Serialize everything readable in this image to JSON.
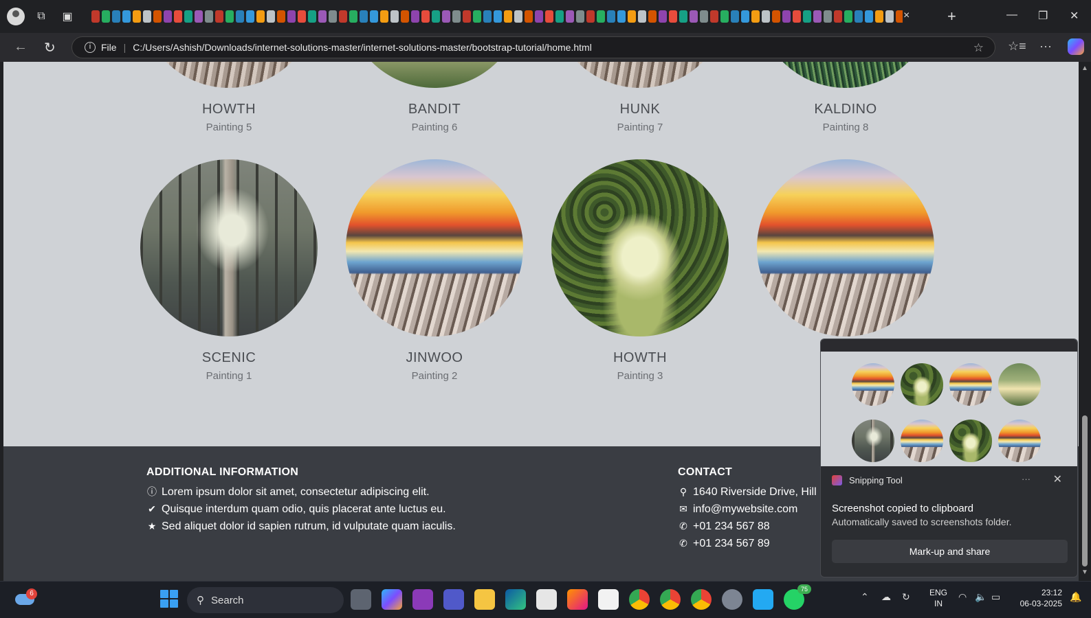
{
  "browser": {
    "url_scheme": "File",
    "url": "C:/Users/Ashish/Downloads/internet-solutions-master/internet-solutions-master/bootstrap-tutorial/home.html",
    "tab_close": "×",
    "new_tab": "+"
  },
  "gallery": {
    "row1": [
      {
        "title": "HOWTH",
        "subtitle": "Painting 5"
      },
      {
        "title": "BANDIT",
        "subtitle": "Painting 6"
      },
      {
        "title": "HUNK",
        "subtitle": "Painting 7"
      },
      {
        "title": "KALDINO",
        "subtitle": "Painting 8"
      }
    ],
    "row2": [
      {
        "title": "SCENIC",
        "subtitle": "Painting 1"
      },
      {
        "title": "JINWOO",
        "subtitle": "Painting 2"
      },
      {
        "title": "HOWTH",
        "subtitle": "Painting 3"
      }
    ]
  },
  "footer": {
    "additional": {
      "heading": "ADDITIONAL INFORMATION",
      "items": [
        "Lorem ipsum dolor sit amet, consectetur adipiscing elit.",
        "Quisque interdum quam odio, quis placerat ante luctus eu.",
        "Sed aliquet dolor id sapien rutrum, id vulputate quam iaculis."
      ]
    },
    "contact": {
      "heading": "CONTACT",
      "address": "1640 Riverside Drive, Hill",
      "email": "info@mywebsite.com",
      "phone1": "+01 234 567 88",
      "phone2": "+01 234 567 89"
    }
  },
  "toast": {
    "app": "Snipping Tool",
    "more": "···",
    "title": "Screenshot copied to clipboard",
    "body": "Automatically saved to screenshots folder.",
    "button": "Mark-up and share"
  },
  "taskbar": {
    "search_label": "Search",
    "weather_badge": "6",
    "whatsapp_badge": "75",
    "lang_1": "ENG",
    "lang_2": "IN",
    "time": "23:12",
    "date": "06-03-2025"
  },
  "colors": {
    "page_bg": "#cfd2d6",
    "footer_bg": "#3a3d43",
    "chrome_bg": "#202124"
  }
}
